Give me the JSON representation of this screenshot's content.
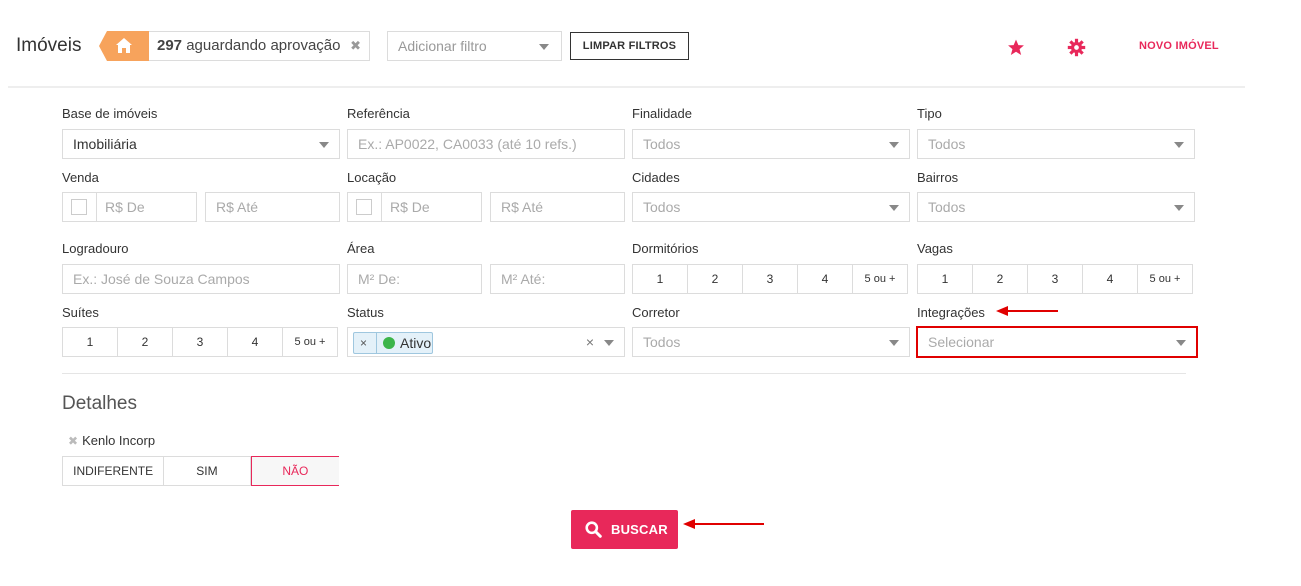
{
  "header": {
    "title": "Imóveis",
    "pending_count": "297",
    "pending_text": "aguardando aprovação",
    "filter_placeholder": "Adicionar filtro",
    "clear_filters": "LIMPAR FILTROS",
    "new_property": "NOVO IMÓVEL"
  },
  "form": {
    "base": {
      "label": "Base de imóveis",
      "value": "Imobiliária"
    },
    "referencia": {
      "label": "Referência",
      "placeholder": "Ex.: AP0022, CA0033 (até 10 refs.)"
    },
    "finalidade": {
      "label": "Finalidade",
      "value": "Todos"
    },
    "tipo": {
      "label": "Tipo",
      "value": "Todos"
    },
    "venda": {
      "label": "Venda",
      "from": "R$ De",
      "to": "R$ Até"
    },
    "locacao": {
      "label": "Locação",
      "from": "R$ De",
      "to": "R$ Até"
    },
    "cidades": {
      "label": "Cidades",
      "value": "Todos"
    },
    "bairros": {
      "label": "Bairros",
      "value": "Todos"
    },
    "logradouro": {
      "label": "Logradouro",
      "placeholder": "Ex.: José de Souza Campos"
    },
    "area": {
      "label": "Área",
      "from": "M² De:",
      "to": "M² Até:"
    },
    "dormitorios": {
      "label": "Dormitórios",
      "options": [
        "1",
        "2",
        "3",
        "4",
        "5 ou +"
      ]
    },
    "vagas": {
      "label": "Vagas",
      "options": [
        "1",
        "2",
        "3",
        "4",
        "5 ou +"
      ]
    },
    "suites": {
      "label": "Suítes",
      "options": [
        "1",
        "2",
        "3",
        "4",
        "5 ou +"
      ]
    },
    "status": {
      "label": "Status",
      "tag": "Ativo",
      "tag_remove": "×",
      "clear": "×"
    },
    "corretor": {
      "label": "Corretor",
      "value": "Todos"
    },
    "integracoes": {
      "label": "Integrações",
      "placeholder": "Selecionar"
    }
  },
  "details": {
    "title": "Detalhes",
    "item_label": "Kenlo Incorp",
    "item_remove": "✖",
    "options": [
      "INDIFERENTE",
      "SIM",
      "NÃO"
    ],
    "selected": "NÃO"
  },
  "search_button": "BUSCAR",
  "colors": {
    "accent": "#e8285a",
    "home_tab": "#f7a35c",
    "highlight": "#e00000",
    "status_dot": "#3cb54a"
  }
}
